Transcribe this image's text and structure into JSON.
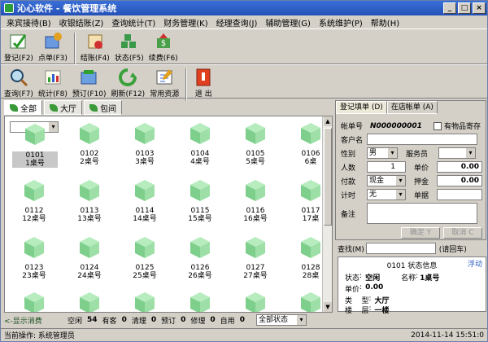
{
  "window": {
    "title": "沁心软件 - 餐饮管理系统"
  },
  "menu": [
    "来宾接待(B)",
    "收银结账(Z)",
    "查询统计(T)",
    "财务管理(K)",
    "经理查询(J)",
    "辅助管理(G)",
    "系统维护(P)",
    "帮助(H)"
  ],
  "toolbar1": [
    {
      "label": "登记(F2)",
      "icon": "register-icon"
    },
    {
      "label": "点单(F3)",
      "icon": "order-icon"
    },
    {
      "label": "结账(F4)",
      "icon": "checkout-icon"
    },
    {
      "label": "状态(F5)",
      "icon": "status-icon"
    },
    {
      "label": "续费(F6)",
      "icon": "renew-icon"
    }
  ],
  "toolbar2": [
    {
      "label": "查询(F7)",
      "icon": "query-icon"
    },
    {
      "label": "统计(F8)",
      "icon": "stats-icon"
    },
    {
      "label": "预订(F10)",
      "icon": "reserve-icon"
    },
    {
      "label": "刷新(F12)",
      "icon": "refresh-icon"
    },
    {
      "label": "常用资源",
      "icon": "resources-icon"
    },
    {
      "label": "退  出",
      "icon": "exit-icon"
    }
  ],
  "area_tabs": [
    "全部",
    "大厅",
    "包间"
  ],
  "tables": [
    {
      "no": "0101",
      "name": "1桌号"
    },
    {
      "no": "0102",
      "name": "2桌号"
    },
    {
      "no": "0103",
      "name": "3桌号"
    },
    {
      "no": "0104",
      "name": "4桌号"
    },
    {
      "no": "0105",
      "name": "5桌号"
    },
    {
      "no": "0106",
      "name": "6桌"
    },
    {
      "no": "0112",
      "name": "12桌号"
    },
    {
      "no": "0113",
      "name": "13桌号"
    },
    {
      "no": "0114",
      "name": "14桌号"
    },
    {
      "no": "0115",
      "name": "15桌号"
    },
    {
      "no": "0116",
      "name": "16桌号"
    },
    {
      "no": "0117",
      "name": "17桌"
    },
    {
      "no": "0123",
      "name": "23桌号"
    },
    {
      "no": "0124",
      "name": "24桌号"
    },
    {
      "no": "0125",
      "name": "25桌号"
    },
    {
      "no": "0126",
      "name": "26桌号"
    },
    {
      "no": "0127",
      "name": "27桌号"
    },
    {
      "no": "0128",
      "name": "28桌"
    }
  ],
  "right_tabs": [
    "登记填单 (D)",
    "在店帐单 (A)"
  ],
  "form": {
    "bill_label": "帐单号",
    "bill_no": "N000000001",
    "item_storage": "有物品寄存",
    "guest_label": "客户名",
    "gender_label": "性别",
    "gender": "男",
    "waiter_label": "服务员",
    "people_label": "人数",
    "people": "1",
    "price_label": "单价",
    "price": "0.00",
    "pay_label": "付款",
    "pay": "现金",
    "deposit_label": "押金",
    "deposit": "0.00",
    "timing_label": "计时",
    "timing": "无",
    "slip_label": "单据",
    "note_label": "备注",
    "ok": "确定 Y",
    "cancel": "取消 C"
  },
  "search": {
    "label": "查找(M)",
    "hint": "(请回车)"
  },
  "status_box": {
    "title": "0101 状态信息",
    "float": "浮动",
    "state_label": "状态",
    "state": "空闲",
    "name_label": "名称",
    "name": "1桌号",
    "price_label": "单价",
    "price": "0.00",
    "type_label": "类    型",
    "type": "大厅",
    "floor_label": "楼    层",
    "floor": "一楼"
  },
  "bottom": {
    "show_consume": "<-显示消费",
    "idle_label": "空闲",
    "idle": "54",
    "guest_label": "有客",
    "guest": "0",
    "clean_label": "清理",
    "clean": "0",
    "reserved_label": "预订",
    "reserved": "0",
    "repair_label": "修理",
    "repair": "0",
    "self_label": "自用",
    "self": "0",
    "filter": "全部状态"
  },
  "statusbar": {
    "op": "当前操作: 系统管理员",
    "time": "2014-11-14 15:51:0"
  }
}
